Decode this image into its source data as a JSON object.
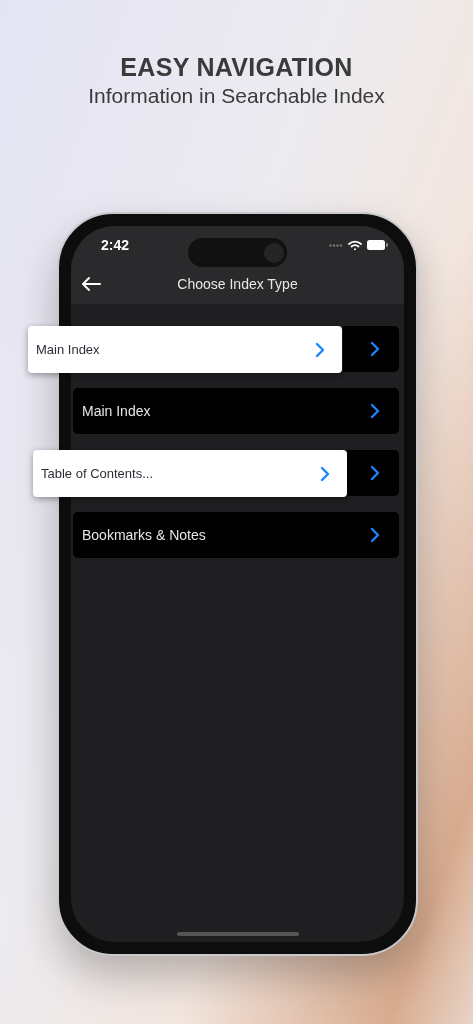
{
  "headline": {
    "title": "EASY NAVIGATION",
    "subtitle": "Information in Searchable Index"
  },
  "status_bar": {
    "time": "2:42"
  },
  "nav_bar": {
    "title": "Choose Index Type"
  },
  "rows": [
    {
      "label": "Main Index",
      "popped": true
    },
    {
      "label": "Main Index",
      "popped": false
    },
    {
      "label": "Table of Contents...",
      "popped": true
    },
    {
      "label": "Bookmarks & Notes",
      "popped": false
    }
  ]
}
